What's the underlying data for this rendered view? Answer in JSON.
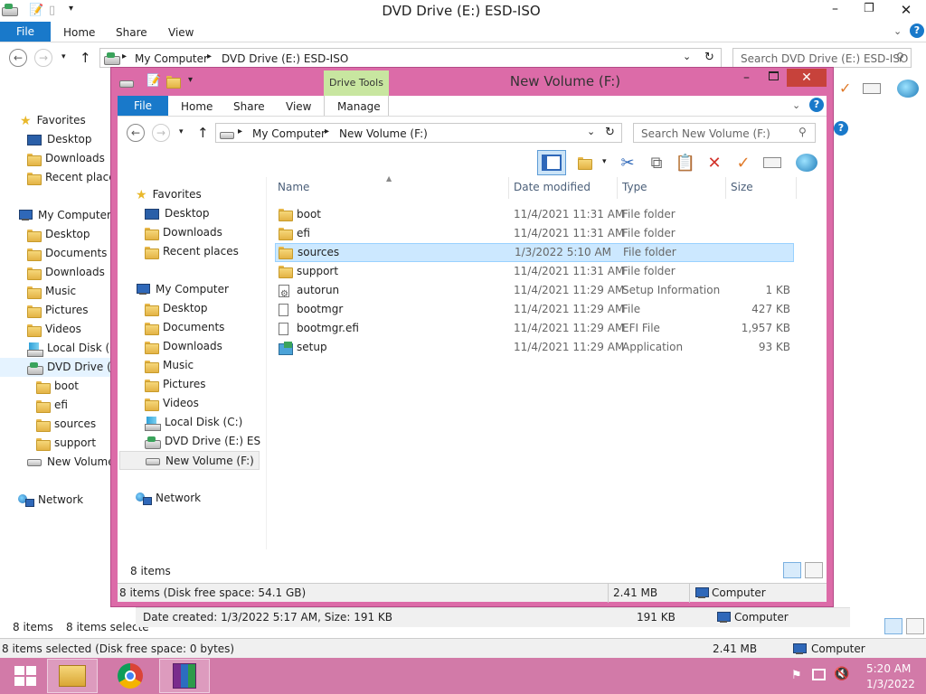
{
  "back": {
    "title": "DVD Drive (E:) ESD-ISO",
    "tabs": [
      "File",
      "Home",
      "Share",
      "View"
    ],
    "address": [
      "My Computer",
      "DVD Drive (E:) ESD-ISO"
    ],
    "search_placeholder": "Search DVD Drive (E:) ESD-ISO",
    "nav": {
      "favorites": "Favorites",
      "fav_items": [
        "Desktop",
        "Downloads",
        "Recent places"
      ],
      "computer": "My Computer",
      "comp_items": [
        "Desktop",
        "Documents",
        "Downloads",
        "Music",
        "Pictures",
        "Videos",
        "Local Disk (C:",
        "DVD Drive (E:)"
      ],
      "dvd_children": [
        "boot",
        "efi",
        "sources",
        "support"
      ],
      "new_volume": "New Volume",
      "network": "Network"
    },
    "status_count": "8 items",
    "status_selected": "8 items selecte",
    "details": "Date created: 1/3/2022 5:17 AM, Size: 191 KB",
    "details_size": "191 KB",
    "details_loc": "Computer",
    "bottom_left": "8 items selected (Disk free space: 0 bytes)",
    "bottom_size": "2.41 MB",
    "bottom_loc": "Computer"
  },
  "front": {
    "title": "New Volume (F:)",
    "drive_tools": "Drive Tools",
    "tabs": [
      "File",
      "Home",
      "Share",
      "View",
      "Manage"
    ],
    "address": [
      "My Computer",
      "New Volume (F:)"
    ],
    "search_placeholder": "Search New Volume (F:)",
    "nav": {
      "favorites": "Favorites",
      "fav_items": [
        "Desktop",
        "Downloads",
        "Recent places"
      ],
      "computer": "My Computer",
      "comp_items": [
        "Desktop",
        "Documents",
        "Downloads",
        "Music",
        "Pictures",
        "Videos",
        "Local Disk (C:)",
        "DVD Drive (E:) ESD-IS",
        "New Volume (F:)"
      ],
      "network": "Network"
    },
    "columns": [
      "Name",
      "Date modified",
      "Type",
      "Size"
    ],
    "files": [
      {
        "name": "boot",
        "date": "11/4/2021 11:31 AM",
        "type": "File folder",
        "size": "",
        "icon": "folder-icon"
      },
      {
        "name": "efi",
        "date": "11/4/2021 11:31 AM",
        "type": "File folder",
        "size": "",
        "icon": "folder-icon"
      },
      {
        "name": "sources",
        "date": "1/3/2022 5:10 AM",
        "type": "File folder",
        "size": "",
        "icon": "folder-icon"
      },
      {
        "name": "support",
        "date": "11/4/2021 11:31 AM",
        "type": "File folder",
        "size": "",
        "icon": "folder-icon"
      },
      {
        "name": "autorun",
        "date": "11/4/2021 11:29 AM",
        "type": "Setup Information",
        "size": "1 KB",
        "icon": "setup-info-icon"
      },
      {
        "name": "bootmgr",
        "date": "11/4/2021 11:29 AM",
        "type": "File",
        "size": "427 KB",
        "icon": "file-icon"
      },
      {
        "name": "bootmgr.efi",
        "date": "11/4/2021 11:29 AM",
        "type": "EFI File",
        "size": "1,957 KB",
        "icon": "file-icon"
      },
      {
        "name": "setup",
        "date": "11/4/2021 11:29 AM",
        "type": "Application",
        "size": "93 KB",
        "icon": "application-icon"
      }
    ],
    "item_count": "8 items",
    "status_left": "8 items (Disk free space: 54.1 GB)",
    "status_size": "2.41 MB",
    "status_loc": "Computer"
  },
  "taskbar": {
    "time": "5:20 AM",
    "date": "1/3/2022"
  },
  "colors": {
    "accent": "#1979ca",
    "window_frame": "#dc6ba8",
    "taskbar": "#d27aa8",
    "selection": "#cce8ff",
    "drive_tools": "#c8e6a0"
  }
}
